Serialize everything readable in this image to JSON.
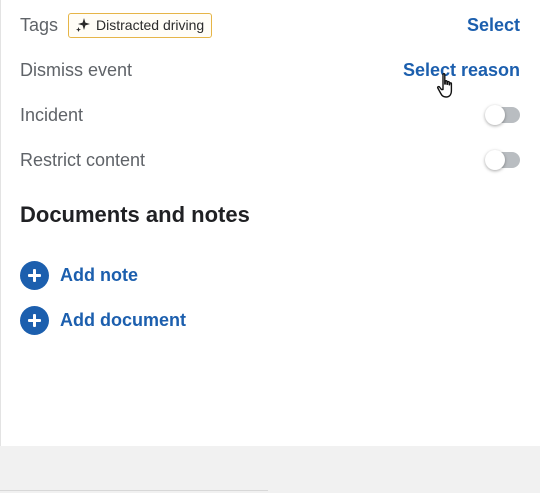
{
  "tags": {
    "label": "Tags",
    "chip": "Distracted driving",
    "chip_icon": "sparkle-icon",
    "action": "Select"
  },
  "dismiss_event": {
    "label": "Dismiss event",
    "action": "Select reason"
  },
  "incident": {
    "label": "Incident",
    "toggle_on": false
  },
  "restrict_content": {
    "label": "Restrict content",
    "toggle_on": false
  },
  "documents": {
    "title": "Documents and notes",
    "add_note": "Add note",
    "add_document": "Add document"
  },
  "colors": {
    "link": "#1c5fae",
    "chip_border": "#e6b547",
    "toggle_off": "#b9bdc1"
  }
}
